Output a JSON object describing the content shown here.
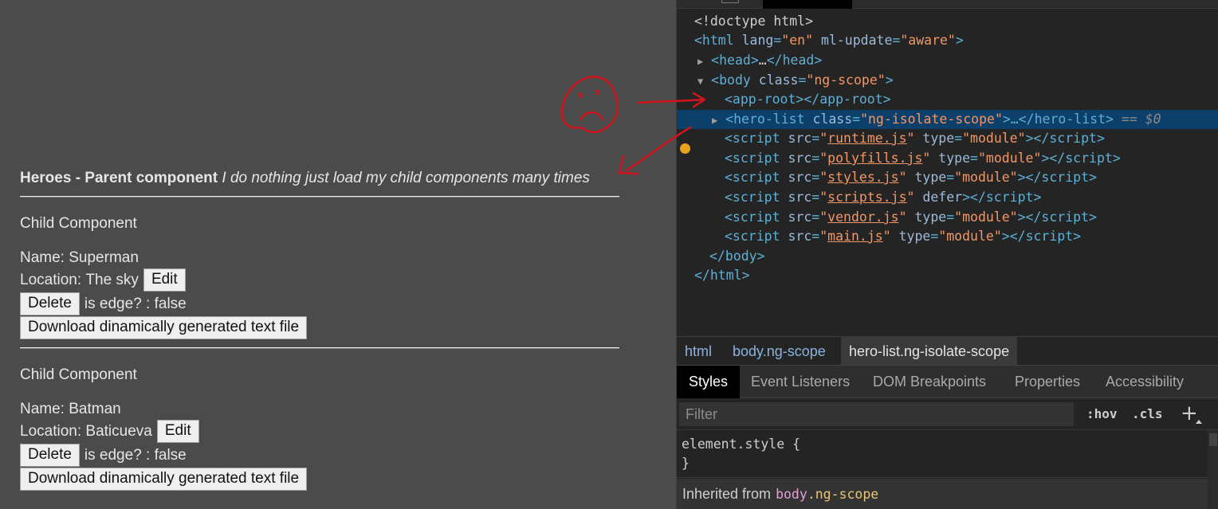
{
  "page": {
    "parent_bold": "Heroes - Parent component",
    "parent_italic": "I do nothing just load my child components many times",
    "children": [
      {
        "title": "Child Component",
        "name_label": "Name:",
        "name": "Superman",
        "location_label": "Location:",
        "location": "The sky",
        "edit_label": "Edit",
        "delete_label": "Delete",
        "edge_text": "is edge? : false",
        "download_label": "Download dinamically generated text file"
      },
      {
        "title": "Child Component",
        "name_label": "Name:",
        "name": "Batman",
        "location_label": "Location:",
        "location": "Baticueva",
        "edit_label": "Edit",
        "delete_label": "Delete",
        "edge_text": "is edge? : false",
        "download_label": "Download dinamically generated text file"
      }
    ]
  },
  "devtools": {
    "elements": {
      "doctype": "<!doctype html>",
      "html_open": {
        "tag": "<html",
        "attr1": "lang",
        "val1": "\"en\"",
        "attr2": "ml-update",
        "val2": "\"aware\"",
        "close": ">"
      },
      "head": {
        "tag": "<head>",
        "ellipsis": "…",
        "close": "</head>"
      },
      "body_open": {
        "tag": "<body",
        "attr": "class",
        "val": "\"ng-scope\"",
        "close": ">"
      },
      "app_root": "<app-root></app-root>",
      "hero_list": {
        "tag": "<hero-list",
        "attr": "class",
        "val": "\"ng-isolate-scope\"",
        "mid": ">…</hero-list>",
        "eq": " == ",
        "ref": "$0"
      },
      "scripts": [
        {
          "src": "runtime.js",
          "extra_attr": "type",
          "extra_val": "\"module\""
        },
        {
          "src": "polyfills.js",
          "extra_attr": "type",
          "extra_val": "\"module\""
        },
        {
          "src": "styles.js",
          "extra_attr": "type",
          "extra_val": "\"module\""
        },
        {
          "src": "scripts.js",
          "extra_attr": "defer",
          "extra_val": ""
        },
        {
          "src": "vendor.js",
          "extra_attr": "type",
          "extra_val": "\"module\""
        },
        {
          "src": "main.js",
          "extra_attr": "type",
          "extra_val": "\"module\""
        }
      ],
      "body_close": "</body>",
      "html_close": "</html>"
    },
    "breadcrumbs": [
      "html",
      "body.ng-scope",
      "hero-list.ng-isolate-scope"
    ],
    "panel_tabs": [
      "Styles",
      "Event Listeners",
      "DOM Breakpoints",
      "Properties",
      "Accessibility"
    ],
    "filter_placeholder": "Filter",
    "hov_label": ":hov",
    "cls_label": ".cls",
    "plus_label": "+",
    "element_style_open": "element.style {",
    "element_style_close": "}",
    "inherited_label": "Inherited from",
    "inherited_tag": "body",
    "inherited_class": ".ng-scope"
  },
  "colors": {
    "page_bg": "#4b4b4b",
    "devtools_bg": "#242424",
    "selected_row": "#0d3f6b",
    "annotation_red": "#d0141b",
    "breakpoint_dot": "#e8a21b"
  }
}
